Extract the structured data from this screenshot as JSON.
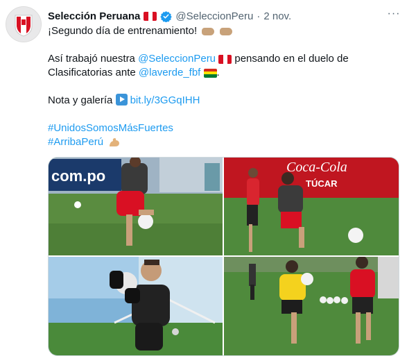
{
  "tweet": {
    "author_name": "Selección Peruana",
    "handle": "@SeleccionPeru",
    "separator": "·",
    "date": "2 nov.",
    "more_label": "···",
    "line1": "¡Segundo día de entrenamiento!",
    "line2_prefix": "Así trabajó nuestra ",
    "line2_mention": "@SeleccionPeru",
    "line2_suffix": " pensando en el duelo de",
    "line3_prefix": "Clasificatorias ante ",
    "line3_mention": "@laverde_fbf",
    "line3_suffix": ".",
    "line4_prefix": "Nota y galería ",
    "line4_link": "bit.ly/3GGqIHH",
    "hashtag1": "#UnidosSomosMásFuertes",
    "hashtag2": "#ArribaPerú"
  },
  "icons": {
    "avatar": "peru-crest-icon",
    "verified": "verified-badge-icon",
    "more": "more-options-icon",
    "hands": "fist-bump-emoji-icon",
    "play": "play-button-emoji-icon",
    "muscle": "flexed-biceps-emoji-icon",
    "flag_peru": "peru-flag-icon",
    "flag_bolivia": "bolivia-flag-icon"
  },
  "gallery": {
    "photo1_banner": "com.po",
    "photo2_banner": "Coca-Cola",
    "photo2_sub": "TÚCAR"
  },
  "colors": {
    "link": "#1d9bf0",
    "peru_red": "#d91023",
    "pitch": "#4f8a3c"
  }
}
